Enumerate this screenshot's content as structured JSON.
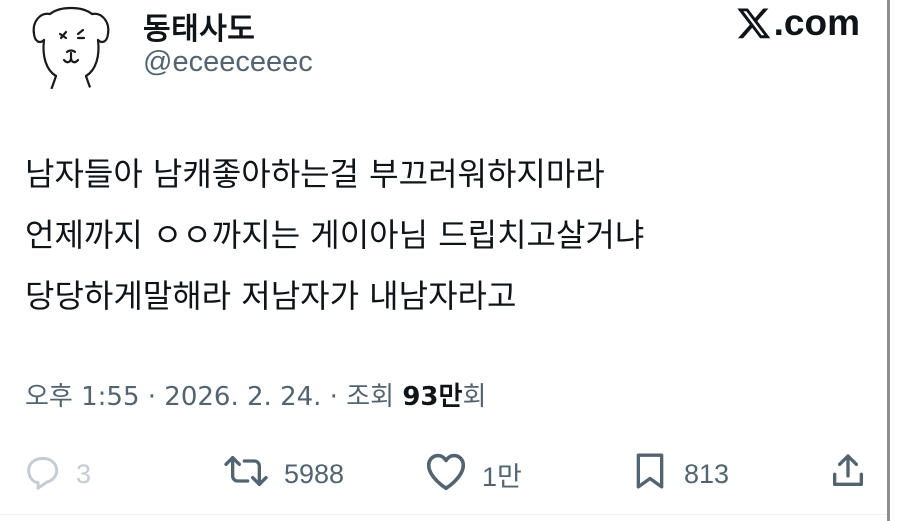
{
  "author": {
    "display_name": "동태사도",
    "handle": "@eceeceeec"
  },
  "brand": {
    "suffix": ".com",
    "icon": "x-logo-icon"
  },
  "tweet": {
    "lines": [
      "남자들아 남캐좋아하는걸 부끄러워하지마라",
      "언제까지 ㅇㅇ까지는 게이아님 드립치고살거냐",
      "당당하게말해라 저남자가 내남자라고"
    ]
  },
  "meta": {
    "time": "오후 1:55",
    "separator": " · ",
    "date": "2026. 2. 24.",
    "separator2": " · ",
    "views_label_before": "조회 ",
    "views_count": "93만",
    "views_label_after": "회"
  },
  "actions": {
    "reply": {
      "icon": "reply-icon",
      "count": "3"
    },
    "retweet": {
      "icon": "retweet-icon",
      "count": "5988"
    },
    "like": {
      "icon": "heart-icon",
      "count": "1만"
    },
    "bookmark": {
      "icon": "bookmark-icon",
      "count": "813"
    },
    "share": {
      "icon": "share-icon"
    }
  },
  "colors": {
    "text": "#0f1419",
    "secondary": "#536471",
    "reply_muted": "#c5ccd3"
  }
}
